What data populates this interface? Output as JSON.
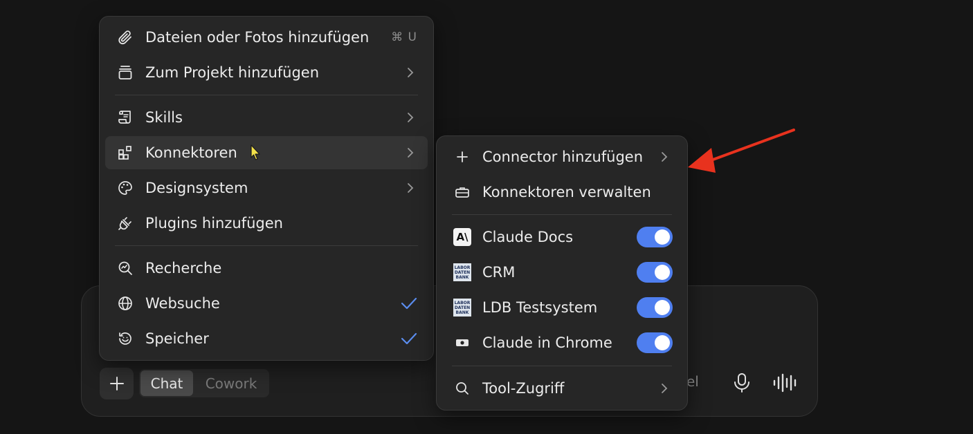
{
  "composer": {
    "mode_chat": "Chat",
    "mode_cowork": "Cowork",
    "model_fragment": "el"
  },
  "main_menu": {
    "items": [
      {
        "label": "Dateien oder Fotos hinzufügen",
        "shortcut": "⌘ U",
        "icon": "paperclip-icon"
      },
      {
        "label": "Zum Projekt hinzufügen",
        "icon": "project-icon",
        "submenu": true
      },
      {
        "label": "Skills",
        "icon": "scroll-icon",
        "submenu": true
      },
      {
        "label": "Konnektoren",
        "icon": "connectors-icon",
        "submenu": true,
        "highlighted": true
      },
      {
        "label": "Designsystem",
        "icon": "palette-icon",
        "submenu": true
      },
      {
        "label": "Plugins hinzufügen",
        "icon": "plug-icon"
      },
      {
        "label": "Recherche",
        "icon": "research-icon"
      },
      {
        "label": "Websuche",
        "icon": "globe-icon",
        "checked": true
      },
      {
        "label": "Speicher",
        "icon": "memory-icon",
        "checked": true
      }
    ]
  },
  "sub_menu": {
    "items": [
      {
        "label": "Connector hinzufügen",
        "icon": "plus-icon",
        "submenu": true
      },
      {
        "label": "Konnektoren verwalten",
        "icon": "briefcase-icon"
      },
      {
        "label": "Claude Docs",
        "icon": "anthropic-logo-icon",
        "enabled": true
      },
      {
        "label": "CRM",
        "icon": "ldb-logo-icon",
        "enabled": true
      },
      {
        "label": "LDB Testsystem",
        "icon": "ldb-logo-icon",
        "enabled": true
      },
      {
        "label": "Claude in Chrome",
        "icon": "chrome-extension-icon",
        "enabled": true
      },
      {
        "label": "Tool-Zugriff",
        "icon": "search-icon",
        "submenu": true
      }
    ],
    "ldb_logo_text": [
      "LABOR",
      "DATEN",
      "BANK"
    ],
    "anthropic_logo_text": "A\\"
  },
  "colors": {
    "background": "#151515",
    "menu_bg": "#262626",
    "toggle_on": "#4f7ff0",
    "check": "#5b8def",
    "annotation_arrow": "#e8321e"
  }
}
